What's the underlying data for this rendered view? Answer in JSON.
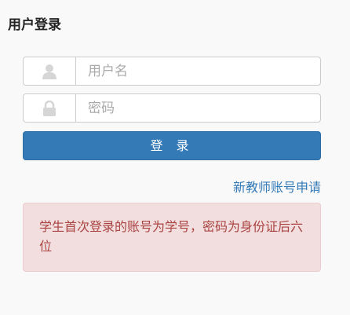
{
  "header": {
    "title": "用户登录"
  },
  "form": {
    "username": {
      "placeholder": "用户名",
      "value": ""
    },
    "password": {
      "placeholder": "密码",
      "value": ""
    },
    "login_label": "登 录",
    "apply_link": "新教师账号申请"
  },
  "notice": {
    "text": "学生首次登录的账号为学号，密码为身份证后六位"
  },
  "icons": {
    "username": "user-icon",
    "password": "lock-icon"
  },
  "colors": {
    "primary": "#337ab7",
    "alert_bg": "#f2dede",
    "alert_text": "#a94442"
  }
}
